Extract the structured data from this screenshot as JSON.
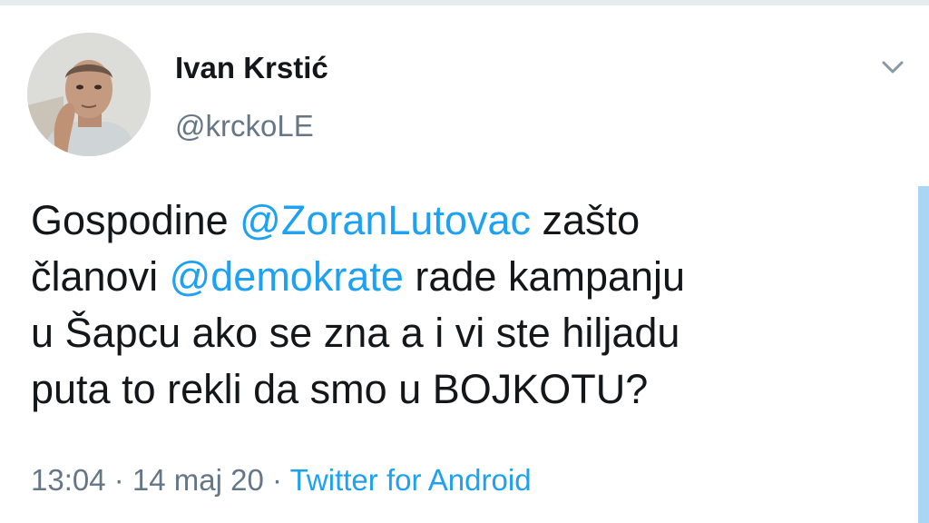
{
  "tweet": {
    "display_name": "Ivan Krstić",
    "username": "@krckoLE",
    "text": {
      "line1_a": "Gospodine ",
      "line1_mention": "@ZoranLutovac",
      "line1_b": " zašto",
      "line2_a": "članovi ",
      "line2_mention": "@demokrate",
      "line2_b": " rade kampanju",
      "line3": "u Šapcu ako se zna a i vi ste hiljadu",
      "line4": "puta to rekli da smo u BOJKOTU?"
    },
    "time": "13:04",
    "separator": " · ",
    "date": "14 maj 20",
    "source": "Twitter for Android"
  },
  "icons": {
    "avatar": "profile-photo",
    "menu": "chevron-down-icon"
  },
  "colors": {
    "accent": "#1da1f2",
    "text": "#14171a",
    "secondary": "#657786",
    "scrollbar": "#aad6f5"
  }
}
